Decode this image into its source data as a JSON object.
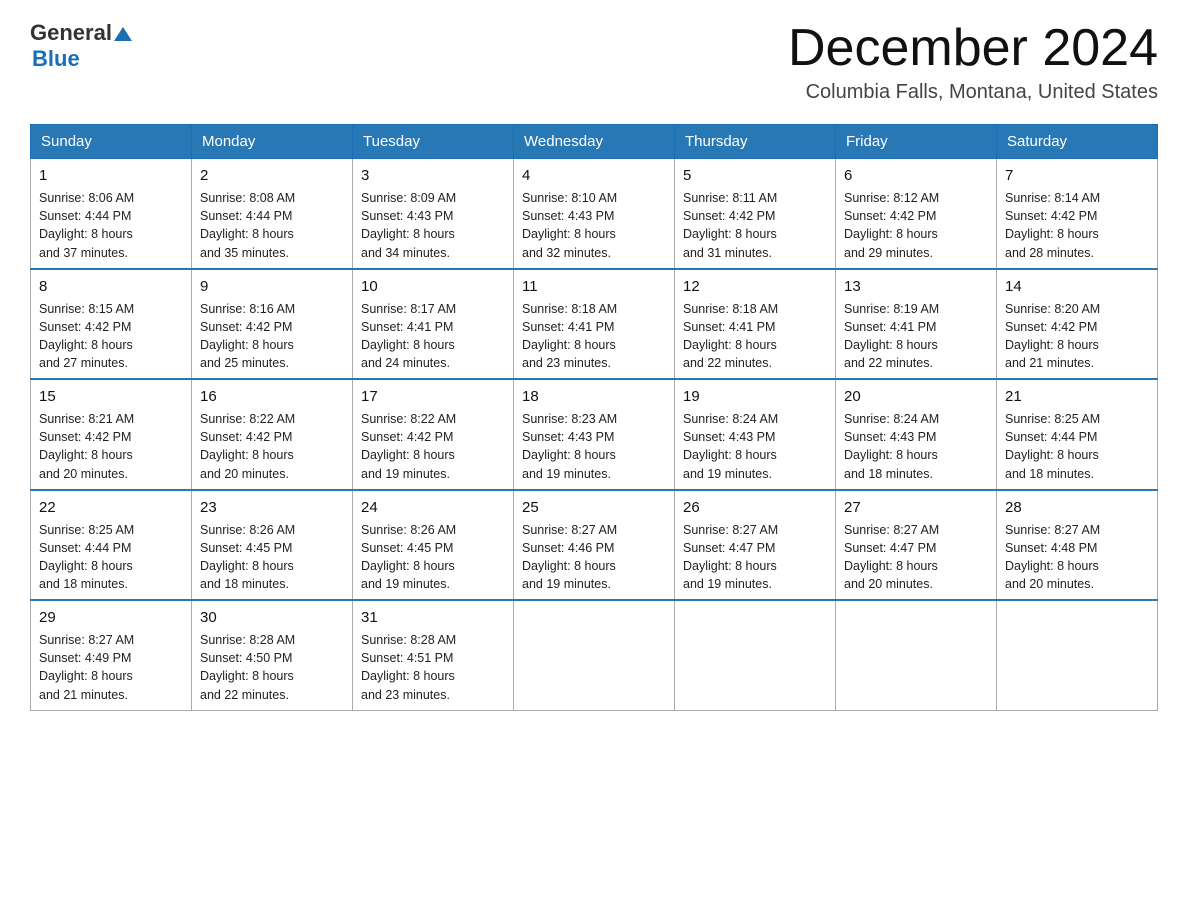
{
  "header": {
    "logo_general": "General",
    "logo_blue": "Blue",
    "month_title": "December 2024",
    "location": "Columbia Falls, Montana, United States"
  },
  "weekdays": [
    "Sunday",
    "Monday",
    "Tuesday",
    "Wednesday",
    "Thursday",
    "Friday",
    "Saturday"
  ],
  "weeks": [
    [
      {
        "day": "1",
        "sunrise": "8:06 AM",
        "sunset": "4:44 PM",
        "daylight": "8 hours and 37 minutes."
      },
      {
        "day": "2",
        "sunrise": "8:08 AM",
        "sunset": "4:44 PM",
        "daylight": "8 hours and 35 minutes."
      },
      {
        "day": "3",
        "sunrise": "8:09 AM",
        "sunset": "4:43 PM",
        "daylight": "8 hours and 34 minutes."
      },
      {
        "day": "4",
        "sunrise": "8:10 AM",
        "sunset": "4:43 PM",
        "daylight": "8 hours and 32 minutes."
      },
      {
        "day": "5",
        "sunrise": "8:11 AM",
        "sunset": "4:42 PM",
        "daylight": "8 hours and 31 minutes."
      },
      {
        "day": "6",
        "sunrise": "8:12 AM",
        "sunset": "4:42 PM",
        "daylight": "8 hours and 29 minutes."
      },
      {
        "day": "7",
        "sunrise": "8:14 AM",
        "sunset": "4:42 PM",
        "daylight": "8 hours and 28 minutes."
      }
    ],
    [
      {
        "day": "8",
        "sunrise": "8:15 AM",
        "sunset": "4:42 PM",
        "daylight": "8 hours and 27 minutes."
      },
      {
        "day": "9",
        "sunrise": "8:16 AM",
        "sunset": "4:42 PM",
        "daylight": "8 hours and 25 minutes."
      },
      {
        "day": "10",
        "sunrise": "8:17 AM",
        "sunset": "4:41 PM",
        "daylight": "8 hours and 24 minutes."
      },
      {
        "day": "11",
        "sunrise": "8:18 AM",
        "sunset": "4:41 PM",
        "daylight": "8 hours and 23 minutes."
      },
      {
        "day": "12",
        "sunrise": "8:18 AM",
        "sunset": "4:41 PM",
        "daylight": "8 hours and 22 minutes."
      },
      {
        "day": "13",
        "sunrise": "8:19 AM",
        "sunset": "4:41 PM",
        "daylight": "8 hours and 22 minutes."
      },
      {
        "day": "14",
        "sunrise": "8:20 AM",
        "sunset": "4:42 PM",
        "daylight": "8 hours and 21 minutes."
      }
    ],
    [
      {
        "day": "15",
        "sunrise": "8:21 AM",
        "sunset": "4:42 PM",
        "daylight": "8 hours and 20 minutes."
      },
      {
        "day": "16",
        "sunrise": "8:22 AM",
        "sunset": "4:42 PM",
        "daylight": "8 hours and 20 minutes."
      },
      {
        "day": "17",
        "sunrise": "8:22 AM",
        "sunset": "4:42 PM",
        "daylight": "8 hours and 19 minutes."
      },
      {
        "day": "18",
        "sunrise": "8:23 AM",
        "sunset": "4:43 PM",
        "daylight": "8 hours and 19 minutes."
      },
      {
        "day": "19",
        "sunrise": "8:24 AM",
        "sunset": "4:43 PM",
        "daylight": "8 hours and 19 minutes."
      },
      {
        "day": "20",
        "sunrise": "8:24 AM",
        "sunset": "4:43 PM",
        "daylight": "8 hours and 18 minutes."
      },
      {
        "day": "21",
        "sunrise": "8:25 AM",
        "sunset": "4:44 PM",
        "daylight": "8 hours and 18 minutes."
      }
    ],
    [
      {
        "day": "22",
        "sunrise": "8:25 AM",
        "sunset": "4:44 PM",
        "daylight": "8 hours and 18 minutes."
      },
      {
        "day": "23",
        "sunrise": "8:26 AM",
        "sunset": "4:45 PM",
        "daylight": "8 hours and 18 minutes."
      },
      {
        "day": "24",
        "sunrise": "8:26 AM",
        "sunset": "4:45 PM",
        "daylight": "8 hours and 19 minutes."
      },
      {
        "day": "25",
        "sunrise": "8:27 AM",
        "sunset": "4:46 PM",
        "daylight": "8 hours and 19 minutes."
      },
      {
        "day": "26",
        "sunrise": "8:27 AM",
        "sunset": "4:47 PM",
        "daylight": "8 hours and 19 minutes."
      },
      {
        "day": "27",
        "sunrise": "8:27 AM",
        "sunset": "4:47 PM",
        "daylight": "8 hours and 20 minutes."
      },
      {
        "day": "28",
        "sunrise": "8:27 AM",
        "sunset": "4:48 PM",
        "daylight": "8 hours and 20 minutes."
      }
    ],
    [
      {
        "day": "29",
        "sunrise": "8:27 AM",
        "sunset": "4:49 PM",
        "daylight": "8 hours and 21 minutes."
      },
      {
        "day": "30",
        "sunrise": "8:28 AM",
        "sunset": "4:50 PM",
        "daylight": "8 hours and 22 minutes."
      },
      {
        "day": "31",
        "sunrise": "8:28 AM",
        "sunset": "4:51 PM",
        "daylight": "8 hours and 23 minutes."
      },
      null,
      null,
      null,
      null
    ]
  ],
  "labels": {
    "sunrise": "Sunrise: ",
    "sunset": "Sunset: ",
    "daylight": "Daylight: "
  }
}
